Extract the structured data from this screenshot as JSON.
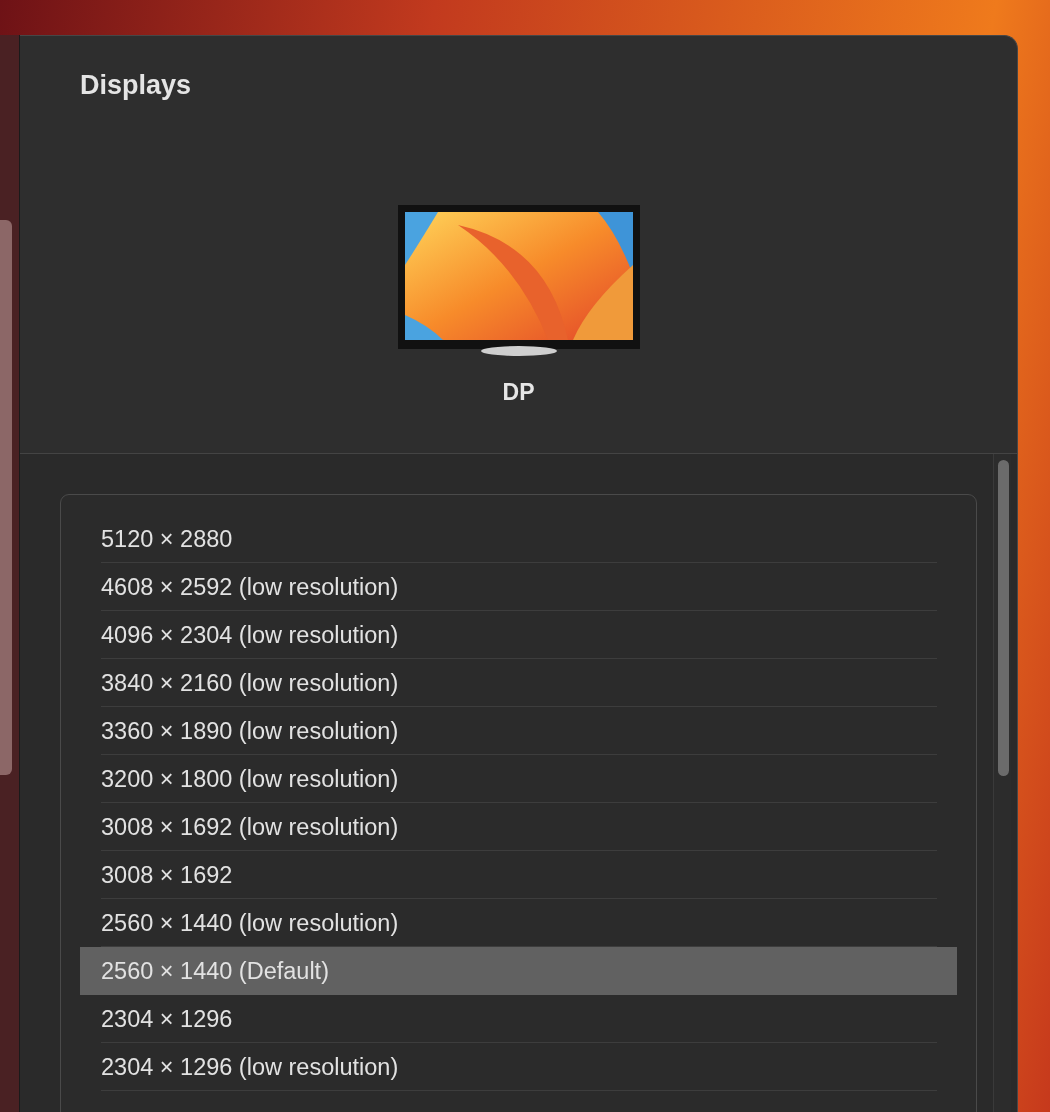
{
  "window": {
    "title": "Displays"
  },
  "display": {
    "name": "DP"
  },
  "resolutions": [
    {
      "label": "5120 × 2880",
      "selected": false
    },
    {
      "label": "4608 × 2592 (low resolution)",
      "selected": false
    },
    {
      "label": "4096 × 2304 (low resolution)",
      "selected": false
    },
    {
      "label": "3840 × 2160 (low resolution)",
      "selected": false
    },
    {
      "label": "3360 × 1890 (low resolution)",
      "selected": false
    },
    {
      "label": "3200 × 1800 (low resolution)",
      "selected": false
    },
    {
      "label": "3008 × 1692 (low resolution)",
      "selected": false
    },
    {
      "label": "3008 × 1692",
      "selected": false
    },
    {
      "label": "2560 × 1440 (low resolution)",
      "selected": false
    },
    {
      "label": "2560 × 1440 (Default)",
      "selected": true
    },
    {
      "label": "2304 × 1296",
      "selected": false
    },
    {
      "label": "2304 × 1296 (low resolution)",
      "selected": false
    }
  ]
}
